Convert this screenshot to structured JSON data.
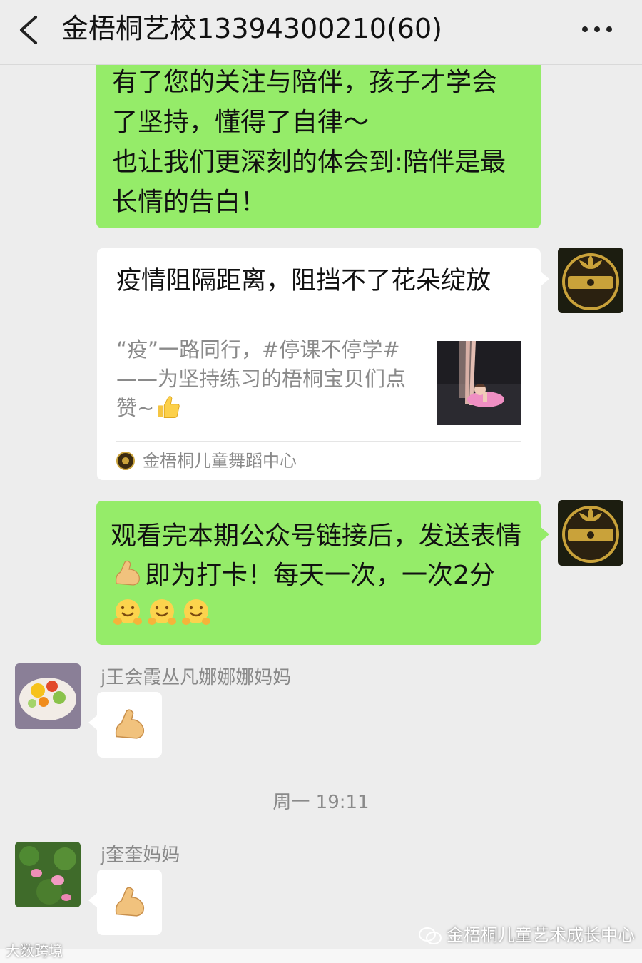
{
  "header": {
    "title": "金梧桐艺校13394300210(60)",
    "back_icon": "chevron-left-icon",
    "more_icon": "more-dots-icon"
  },
  "messages": {
    "msg1": {
      "lines": [
        "有了您的关注与陪伴，孩子才学会",
        "了坚持，懂得了自律～",
        "也让我们更深刻的体会到:陪伴是最",
        "长情的告白！"
      ]
    },
    "card": {
      "title": "疫情阻隔距离，阻挡不了花朵绽放",
      "desc": "“疫”一路同行，#停课不停学#——为坚持练习的梧桐宝贝们点赞~",
      "desc_emoji": "thumbs-up-icon",
      "source": "金梧桐儿童舞蹈中心"
    },
    "msg3": {
      "text_a": "观看完本期公众号链接后，发送表情",
      "text_b": "即为打卡！每天一次，一次2分",
      "emoji_flex": "flexed-biceps-icon",
      "emoji_hug": "hugging-face-icon"
    },
    "reply1": {
      "sender": "j王会霞丛凡娜娜娜妈妈",
      "emoji": "flexed-biceps-icon"
    },
    "timestamp": "周一 19:11",
    "reply2": {
      "sender": "j奎奎妈妈",
      "emoji": "flexed-biceps-icon"
    }
  },
  "watermarks": {
    "right": "金梧桐儿童艺术成长中心",
    "left": "大数跨境"
  },
  "colors": {
    "background": "#ededed",
    "sent_bubble": "#95ec69",
    "received_bubble": "#ffffff",
    "avatar_logo_gold": "#c9a23a"
  }
}
